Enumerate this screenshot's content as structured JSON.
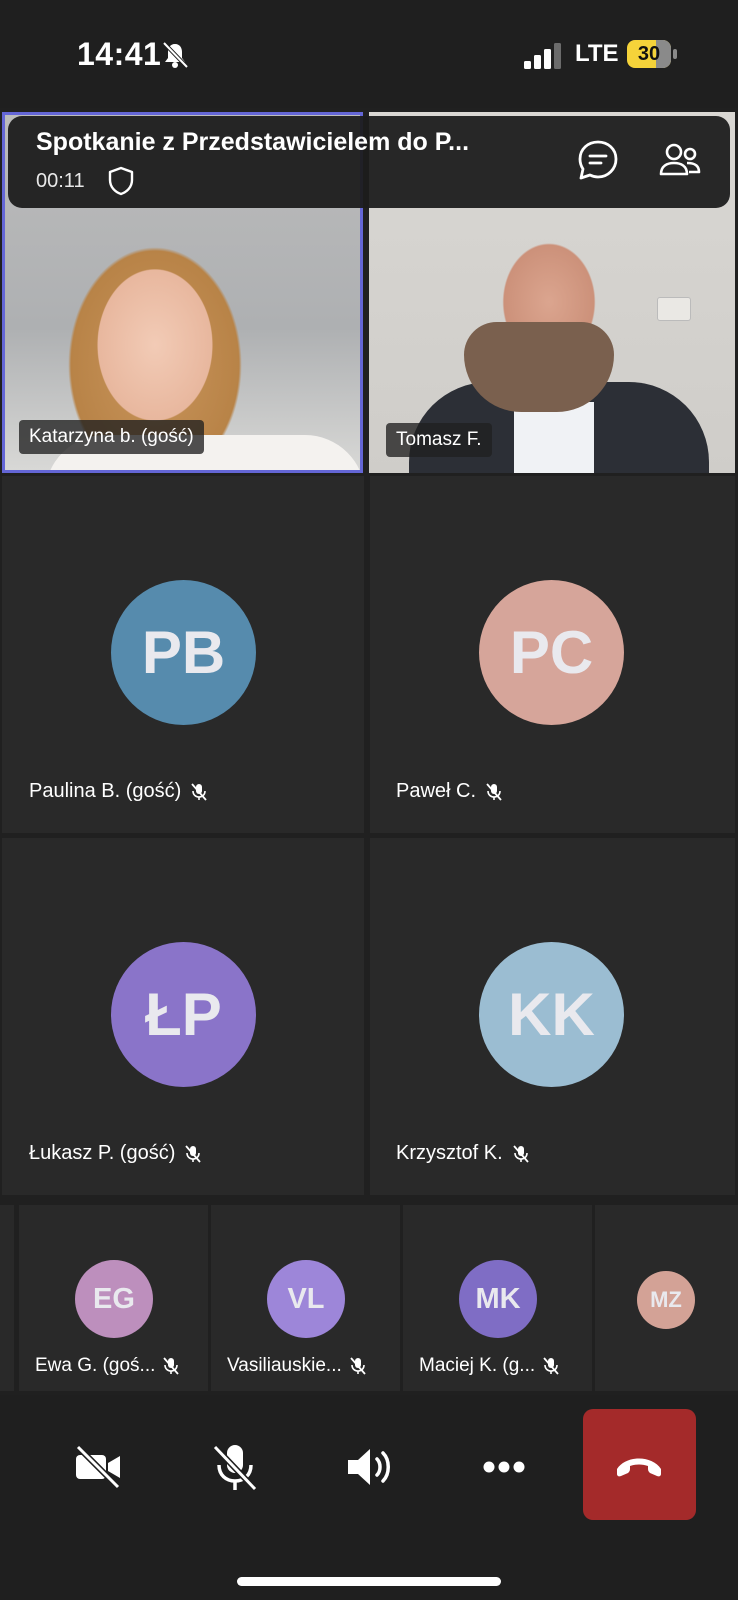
{
  "status_bar": {
    "time": "14:41",
    "network": "LTE",
    "battery": "30",
    "battery_level_pct": 30,
    "silent_mode_icon": "bell-slash-icon",
    "signal_icon": "cellular-signal-icon"
  },
  "meeting": {
    "title": "Spotkanie z Przedstawicielem do P...",
    "elapsed": "00:11",
    "shield_icon": "shield-icon",
    "chat_icon": "chat-icon",
    "participants_icon": "participants-icon"
  },
  "video_participants": [
    {
      "name": "Katarzyna b. (gość)",
      "speaking": true
    },
    {
      "name": "Tomasz F.",
      "speaking": false
    }
  ],
  "avatar_participants": [
    {
      "initials": "PB",
      "name": "Paulina B. (gość)",
      "color": "#568bad",
      "muted": true
    },
    {
      "initials": "PC",
      "name": "Paweł C.",
      "color": "#d6a59a",
      "muted": true
    },
    {
      "initials": "ŁP",
      "name": "Łukasz P. (gość)",
      "color": "#8a74c9",
      "muted": true
    },
    {
      "initials": "KK",
      "name": "Krzysztof K.",
      "color": "#9bbdd2",
      "muted": true
    }
  ],
  "strip_participants": [
    {
      "initials": "EG",
      "name": "Ewa G. (goś...",
      "color": "#bd8fbd",
      "muted": true
    },
    {
      "initials": "VL",
      "name": "Vasiliauskie...",
      "color": "#9d86d9",
      "muted": true
    },
    {
      "initials": "MK",
      "name": "Maciej K. (g...",
      "color": "#7f6dc5",
      "muted": true
    },
    {
      "initials": "MZ",
      "name": "",
      "color": "#d3a296",
      "muted": false
    }
  ],
  "controls": {
    "camera_icon": "camera-off-icon",
    "mic_icon": "mic-off-icon",
    "speaker_icon": "speaker-icon",
    "more_icon": "more-icon",
    "end_call_icon": "end-call-icon",
    "end_call_color": "#a42a2a"
  }
}
